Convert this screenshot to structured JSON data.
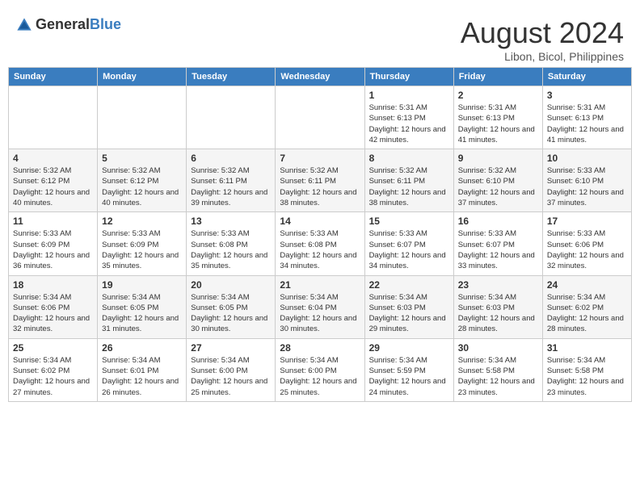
{
  "header": {
    "logo_general": "General",
    "logo_blue": "Blue",
    "month_title": "August 2024",
    "location": "Libon, Bicol, Philippines"
  },
  "weekdays": [
    "Sunday",
    "Monday",
    "Tuesday",
    "Wednesday",
    "Thursday",
    "Friday",
    "Saturday"
  ],
  "weeks": [
    [
      {
        "day": "",
        "info": ""
      },
      {
        "day": "",
        "info": ""
      },
      {
        "day": "",
        "info": ""
      },
      {
        "day": "",
        "info": ""
      },
      {
        "day": "1",
        "info": "Sunrise: 5:31 AM\nSunset: 6:13 PM\nDaylight: 12 hours and 42 minutes."
      },
      {
        "day": "2",
        "info": "Sunrise: 5:31 AM\nSunset: 6:13 PM\nDaylight: 12 hours and 41 minutes."
      },
      {
        "day": "3",
        "info": "Sunrise: 5:31 AM\nSunset: 6:13 PM\nDaylight: 12 hours and 41 minutes."
      }
    ],
    [
      {
        "day": "4",
        "info": "Sunrise: 5:32 AM\nSunset: 6:12 PM\nDaylight: 12 hours and 40 minutes."
      },
      {
        "day": "5",
        "info": "Sunrise: 5:32 AM\nSunset: 6:12 PM\nDaylight: 12 hours and 40 minutes."
      },
      {
        "day": "6",
        "info": "Sunrise: 5:32 AM\nSunset: 6:11 PM\nDaylight: 12 hours and 39 minutes."
      },
      {
        "day": "7",
        "info": "Sunrise: 5:32 AM\nSunset: 6:11 PM\nDaylight: 12 hours and 38 minutes."
      },
      {
        "day": "8",
        "info": "Sunrise: 5:32 AM\nSunset: 6:11 PM\nDaylight: 12 hours and 38 minutes."
      },
      {
        "day": "9",
        "info": "Sunrise: 5:32 AM\nSunset: 6:10 PM\nDaylight: 12 hours and 37 minutes."
      },
      {
        "day": "10",
        "info": "Sunrise: 5:33 AM\nSunset: 6:10 PM\nDaylight: 12 hours and 37 minutes."
      }
    ],
    [
      {
        "day": "11",
        "info": "Sunrise: 5:33 AM\nSunset: 6:09 PM\nDaylight: 12 hours and 36 minutes."
      },
      {
        "day": "12",
        "info": "Sunrise: 5:33 AM\nSunset: 6:09 PM\nDaylight: 12 hours and 35 minutes."
      },
      {
        "day": "13",
        "info": "Sunrise: 5:33 AM\nSunset: 6:08 PM\nDaylight: 12 hours and 35 minutes."
      },
      {
        "day": "14",
        "info": "Sunrise: 5:33 AM\nSunset: 6:08 PM\nDaylight: 12 hours and 34 minutes."
      },
      {
        "day": "15",
        "info": "Sunrise: 5:33 AM\nSunset: 6:07 PM\nDaylight: 12 hours and 34 minutes."
      },
      {
        "day": "16",
        "info": "Sunrise: 5:33 AM\nSunset: 6:07 PM\nDaylight: 12 hours and 33 minutes."
      },
      {
        "day": "17",
        "info": "Sunrise: 5:33 AM\nSunset: 6:06 PM\nDaylight: 12 hours and 32 minutes."
      }
    ],
    [
      {
        "day": "18",
        "info": "Sunrise: 5:34 AM\nSunset: 6:06 PM\nDaylight: 12 hours and 32 minutes."
      },
      {
        "day": "19",
        "info": "Sunrise: 5:34 AM\nSunset: 6:05 PM\nDaylight: 12 hours and 31 minutes."
      },
      {
        "day": "20",
        "info": "Sunrise: 5:34 AM\nSunset: 6:05 PM\nDaylight: 12 hours and 30 minutes."
      },
      {
        "day": "21",
        "info": "Sunrise: 5:34 AM\nSunset: 6:04 PM\nDaylight: 12 hours and 30 minutes."
      },
      {
        "day": "22",
        "info": "Sunrise: 5:34 AM\nSunset: 6:03 PM\nDaylight: 12 hours and 29 minutes."
      },
      {
        "day": "23",
        "info": "Sunrise: 5:34 AM\nSunset: 6:03 PM\nDaylight: 12 hours and 28 minutes."
      },
      {
        "day": "24",
        "info": "Sunrise: 5:34 AM\nSunset: 6:02 PM\nDaylight: 12 hours and 28 minutes."
      }
    ],
    [
      {
        "day": "25",
        "info": "Sunrise: 5:34 AM\nSunset: 6:02 PM\nDaylight: 12 hours and 27 minutes."
      },
      {
        "day": "26",
        "info": "Sunrise: 5:34 AM\nSunset: 6:01 PM\nDaylight: 12 hours and 26 minutes."
      },
      {
        "day": "27",
        "info": "Sunrise: 5:34 AM\nSunset: 6:00 PM\nDaylight: 12 hours and 25 minutes."
      },
      {
        "day": "28",
        "info": "Sunrise: 5:34 AM\nSunset: 6:00 PM\nDaylight: 12 hours and 25 minutes."
      },
      {
        "day": "29",
        "info": "Sunrise: 5:34 AM\nSunset: 5:59 PM\nDaylight: 12 hours and 24 minutes."
      },
      {
        "day": "30",
        "info": "Sunrise: 5:34 AM\nSunset: 5:58 PM\nDaylight: 12 hours and 23 minutes."
      },
      {
        "day": "31",
        "info": "Sunrise: 5:34 AM\nSunset: 5:58 PM\nDaylight: 12 hours and 23 minutes."
      }
    ]
  ]
}
